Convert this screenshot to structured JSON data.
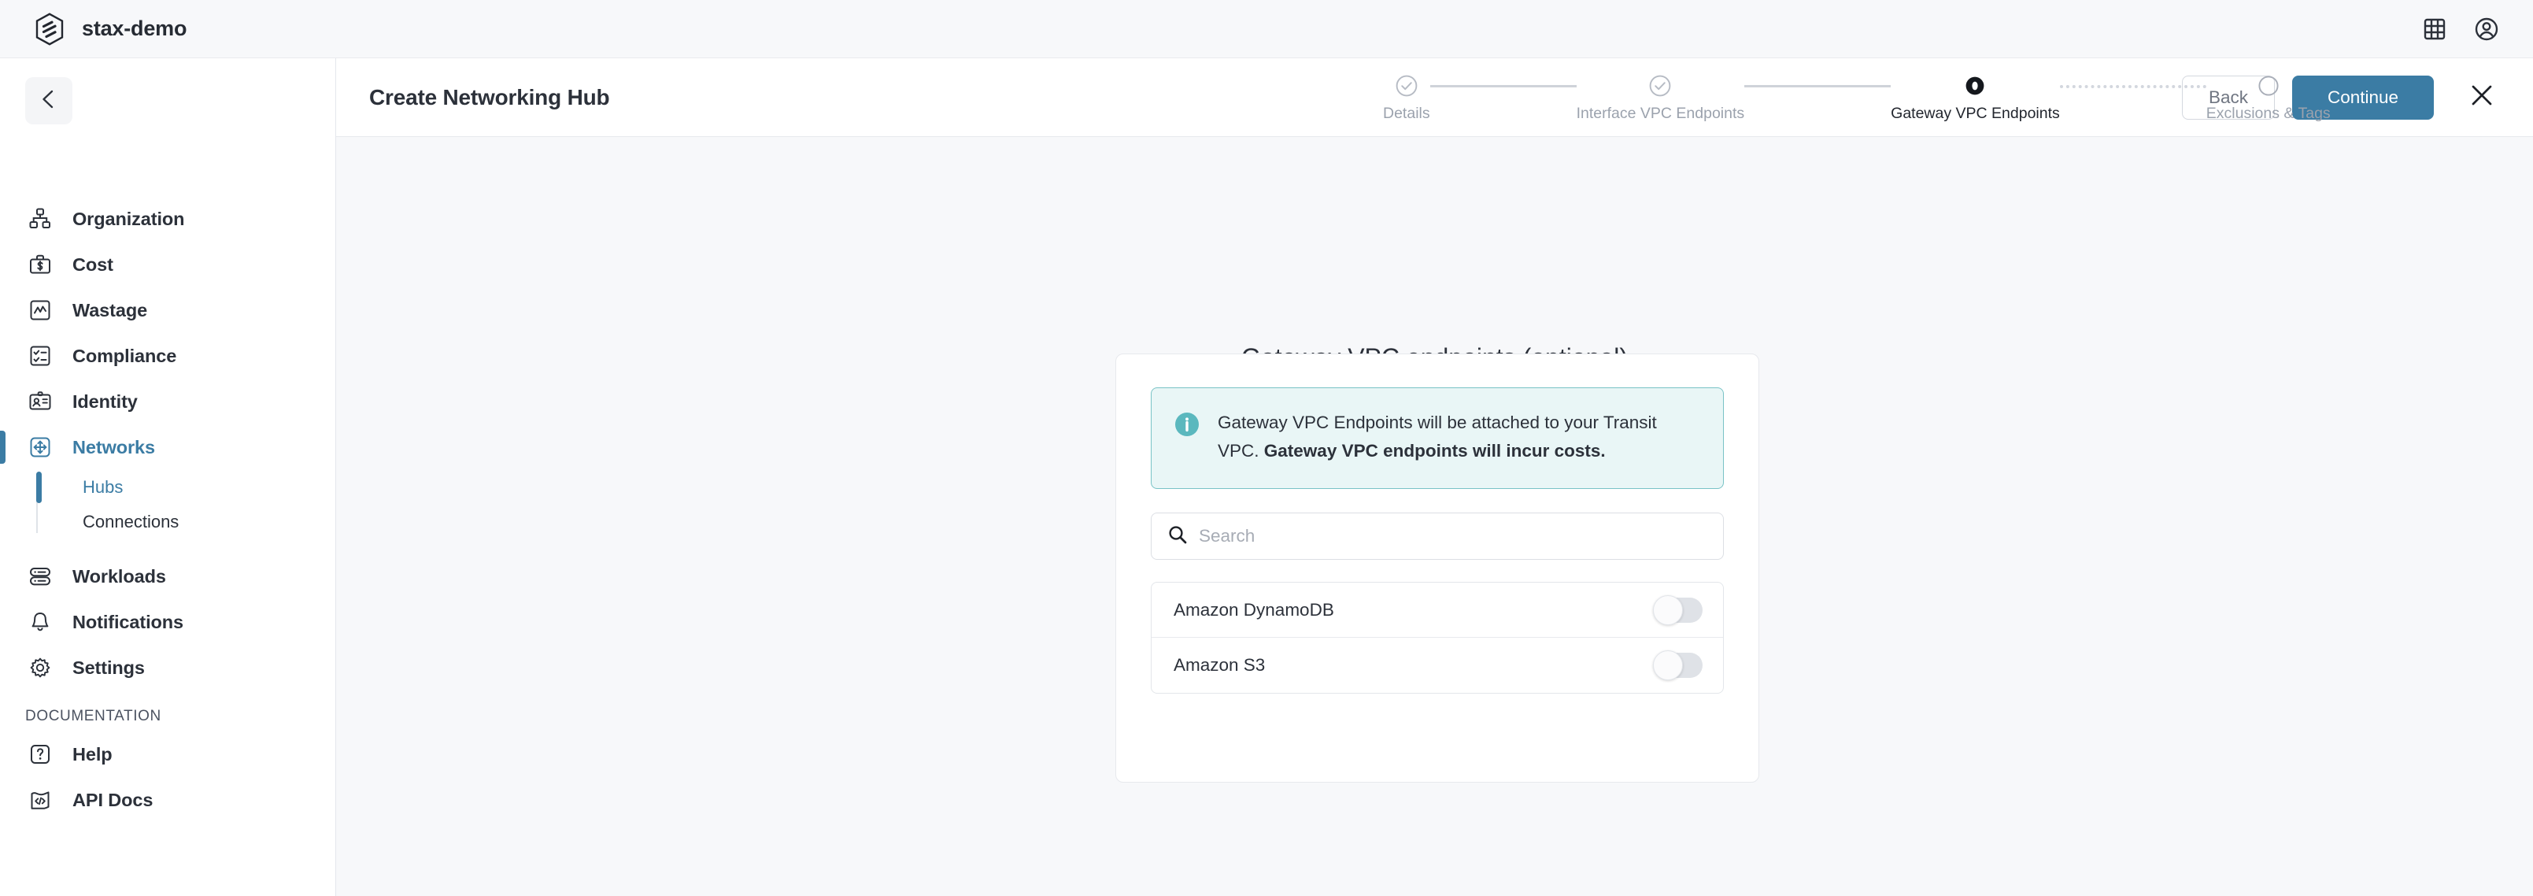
{
  "topbar": {
    "brand_name": "stax-demo",
    "logo_icon": "stax-hexagon-logo",
    "apps_icon": "grid-apps-icon",
    "account_icon": "account-circle-icon"
  },
  "sidebar": {
    "collapse_icon": "chevron-left-icon",
    "items": [
      {
        "label": "Organization",
        "icon": "org-chart-icon",
        "active": false
      },
      {
        "label": "Cost",
        "icon": "briefcase-dollar-icon",
        "active": false
      },
      {
        "label": "Wastage",
        "icon": "chart-line-box-icon",
        "active": false
      },
      {
        "label": "Compliance",
        "icon": "checklist-box-icon",
        "active": false
      },
      {
        "label": "Identity",
        "icon": "id-card-icon",
        "active": false
      },
      {
        "label": "Networks",
        "icon": "move-arrows-box-icon",
        "active": true
      }
    ],
    "subitems": [
      {
        "label": "Hubs",
        "active": true
      },
      {
        "label": "Connections",
        "active": false
      }
    ],
    "items_lower": [
      {
        "label": "Workloads",
        "icon": "server-stack-icon",
        "active": false
      },
      {
        "label": "Notifications",
        "icon": "bell-icon",
        "active": false
      },
      {
        "label": "Settings",
        "icon": "gear-icon",
        "active": false
      }
    ],
    "section_title": "DOCUMENTATION",
    "items_docs": [
      {
        "label": "Help",
        "icon": "question-box-icon",
        "active": false
      },
      {
        "label": "API Docs",
        "icon": "code-document-icon",
        "active": false
      }
    ]
  },
  "header": {
    "page_title": "Create Networking Hub",
    "back_label": "Back",
    "continue_label": "Continue",
    "close_icon": "close-x-icon",
    "steps": [
      {
        "label": "Details",
        "state": "complete"
      },
      {
        "label": "Interface VPC Endpoints",
        "state": "complete"
      },
      {
        "label": "Gateway VPC Endpoints",
        "state": "current"
      },
      {
        "label": "Exclusions & Tags",
        "state": "pending"
      }
    ]
  },
  "main": {
    "title": "Gateway VPC endpoints (optional)",
    "alert": {
      "icon": "info-circle-icon",
      "text_plain": "Gateway VPC Endpoints will be attached to your Transit VPC. ",
      "text_bold": "Gateway VPC endpoints will incur costs."
    },
    "search": {
      "icon": "search-icon",
      "value": "",
      "placeholder": "Search"
    },
    "endpoints": [
      {
        "label": "Amazon DynamoDB",
        "enabled": false
      },
      {
        "label": "Amazon S3",
        "enabled": false
      }
    ]
  },
  "colors": {
    "accent": "#3b7ca4",
    "info_bg": "#e9f6f6",
    "info_border": "#79c3c6",
    "info_icon": "#5bb8be",
    "page_bg": "#f7f8fa",
    "text": "#2c313a",
    "muted": "#9ba2ad"
  }
}
